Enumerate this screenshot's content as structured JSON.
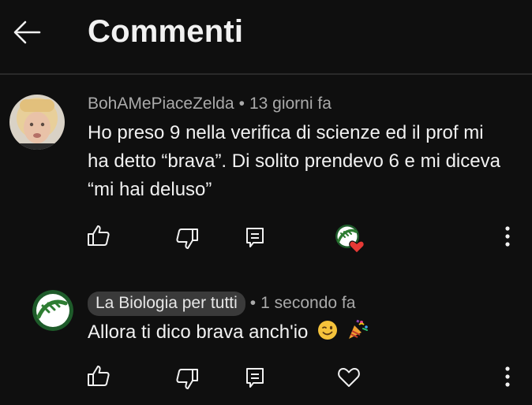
{
  "header": {
    "back_icon": "arrow-left-icon",
    "title": "Commenti"
  },
  "comments": [
    {
      "author": "BohAMePiaceZelda",
      "separator": "•",
      "time": "13 giorni fa",
      "text": "Ho preso 9 nella verifica di scienze ed il prof mi ha detto “brava”. Di solito prendevo 6 e mi diceva “mi hai deluso”",
      "actions": [
        "like-icon",
        "dislike-icon",
        "reply-icon",
        "creator-heart-icon",
        "more-vert-icon"
      ]
    },
    {
      "author": "La Biologia per tutti",
      "separator": "•",
      "time": "1 secondo fa",
      "text": "Allora ti dico brava anch'io",
      "emojis": [
        "wink-emoji",
        "party-popper-emoji"
      ],
      "actions": [
        "like-icon",
        "dislike-icon",
        "reply-icon",
        "heart-outline-icon",
        "more-vert-icon"
      ]
    }
  ],
  "colors": {
    "background": "#0f0f0f",
    "text": "#f1f1f1",
    "meta": "#aaaaaa",
    "chip": "#3a3a3a",
    "brand_green": "#2e7d32",
    "heart_red": "#e53935"
  }
}
